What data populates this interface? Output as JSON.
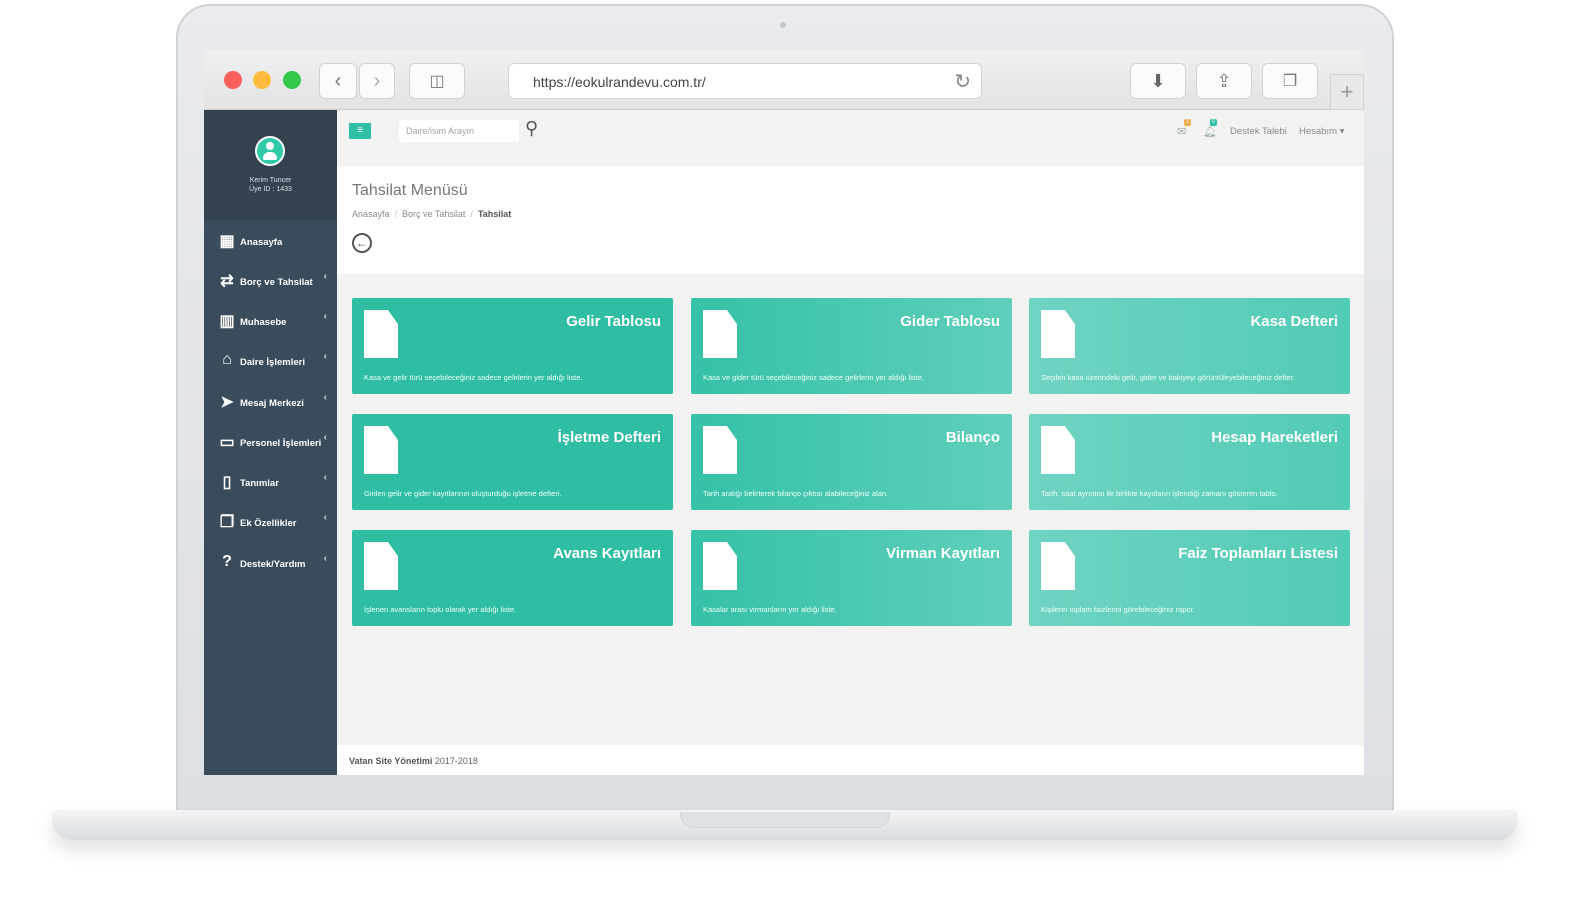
{
  "browser": {
    "url": "https://eokulrandevu.com.tr/"
  },
  "profile": {
    "name": "Kerim Tuncer",
    "member_id": "Üye ID : 1433"
  },
  "sidebar": {
    "items": [
      {
        "label": "Anasayfa",
        "icon": "dashboard-icon",
        "glyph": "▦"
      },
      {
        "label": "Borç ve Tahsilat",
        "icon": "exchange-icon",
        "glyph": "⇄"
      },
      {
        "label": "Muhasebe",
        "icon": "bar-chart-icon",
        "glyph": "▥"
      },
      {
        "label": "Daire İşlemleri",
        "icon": "home-icon",
        "glyph": "⌂"
      },
      {
        "label": "Mesaj Merkezi",
        "icon": "paper-plane-icon",
        "glyph": "➤"
      },
      {
        "label": "Personel İşlemleri",
        "icon": "monitor-icon",
        "glyph": "▭"
      },
      {
        "label": "Tanımlar",
        "icon": "document-icon",
        "glyph": "▯"
      },
      {
        "label": "Ek Özellikler",
        "icon": "copy-icon",
        "glyph": "❐"
      },
      {
        "label": "Destek/Yardım",
        "icon": "question-icon",
        "glyph": "?"
      }
    ]
  },
  "topbar": {
    "search_placeholder": "Daire/isim Arayın",
    "support_label": "Destek Talebi",
    "account_label": "Hesabım",
    "badge_one": "1",
    "badge_two": "0"
  },
  "page": {
    "title": "Tahsilat Menüsü",
    "breadcrumb": [
      "Anasayfa",
      "Borç ve Tahsilat",
      "Tahsilat"
    ]
  },
  "cards": [
    {
      "title": "Gelir Tablosu",
      "desc": "Kasa ve gelir türü seçebileceğiniz sadece gelirlerin yer aldığı liste."
    },
    {
      "title": "Gider Tablosu",
      "desc": "Kasa ve gider türü seçebileceğiniz sadece gelirlerin yer aldığı liste."
    },
    {
      "title": "Kasa Defteri",
      "desc": "Seçilen kasa üzerindeki gelir, gider ve bakiyeyi görüntüleyebileceğiniz defter."
    },
    {
      "title": "İşletme Defteri",
      "desc": "Girilen gelir ve gider kayıtlarının oluşturduğu işletme defteri."
    },
    {
      "title": "Bilanço",
      "desc": "Tarih aralığı belirterek bilanço çıktısı alabileceğiniz alan."
    },
    {
      "title": "Hesap Hareketleri",
      "desc": "Tarih, saat ayrıntısı ile birlikte kayıtların işlendiği zamanı gösteren tablo."
    },
    {
      "title": "Avans Kayıtları",
      "desc": "İşlenen avansların toplu olarak yer aldığı liste."
    },
    {
      "title": "Virman Kayıtları",
      "desc": "Kasalar arası virmanların yer aldığı liste."
    },
    {
      "title": "Faiz Toplamları Listesi",
      "desc": "Kişilerin toplam faizlerini görebileceğiniz rapor."
    }
  ],
  "footer": {
    "brand": "Vatan Site Yönetimi",
    "years": "2017-2018"
  },
  "colors": {
    "sidebar": "#3a4b5c",
    "accent": "#2ebfa5",
    "card_dark": "#2fbea3",
    "card_light": "#6fd3c2"
  }
}
